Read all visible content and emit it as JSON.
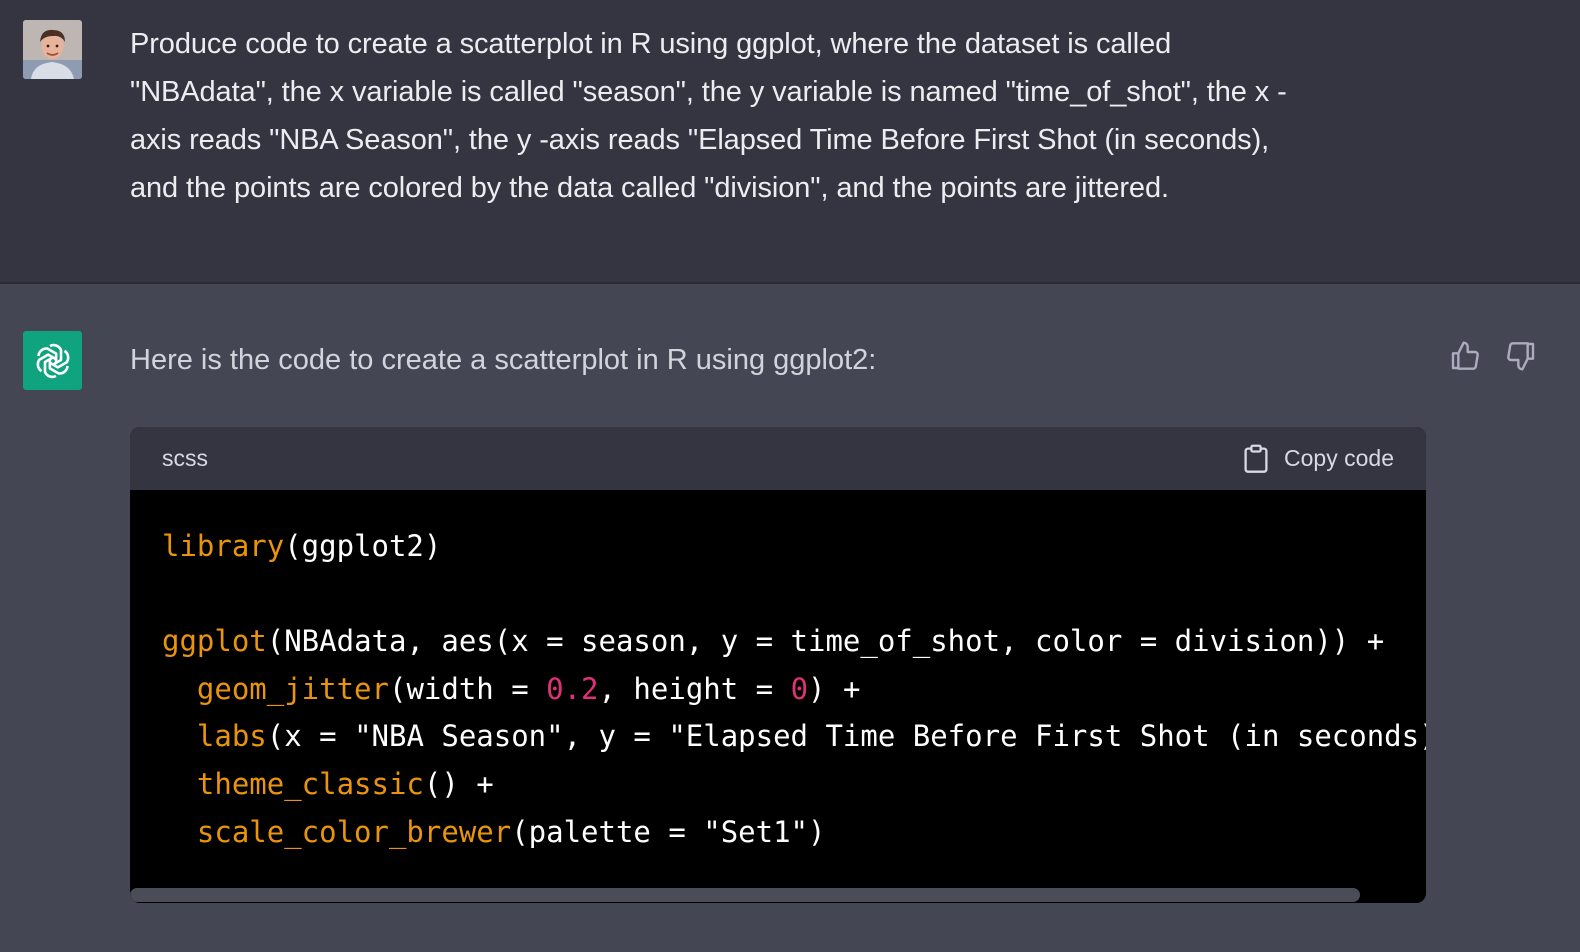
{
  "user": {
    "avatar": "user-photo-avatar",
    "prompt_lines": [
      "Produce code to create a scatterplot in R using ggplot, where the dataset is called",
      "\"NBAdata\", the x variable is called \"season\", the y variable is named \"time_of_shot\", the x -",
      "axis reads \"NBA Season\", the y -axis reads \"Elapsed Time Before First Shot (in seconds),",
      "and the points are colored by the data called \"division\", and the points are jittered."
    ]
  },
  "assistant": {
    "avatar": "openai-logo-icon",
    "intro": "Here is the code to create a scatterplot in R using ggplot2:",
    "feedback": {
      "up": "thumbs-up-icon",
      "down": "thumbs-down-icon"
    },
    "code_block": {
      "language": "scss",
      "copy_label": "Copy code",
      "lines": [
        [
          {
            "t": "library",
            "c": "fn"
          },
          {
            "t": "(ggplot2)",
            "c": "plain"
          }
        ],
        [],
        [
          {
            "t": "ggplot",
            "c": "fn"
          },
          {
            "t": "(NBAdata, aes(x = season, y = time_of_shot, color = division)) +",
            "c": "plain"
          }
        ],
        [
          {
            "t": "  ",
            "c": "plain"
          },
          {
            "t": "geom_jitter",
            "c": "fn"
          },
          {
            "t": "(width = ",
            "c": "plain"
          },
          {
            "t": "0.2",
            "c": "num"
          },
          {
            "t": ", height = ",
            "c": "plain"
          },
          {
            "t": "0",
            "c": "num"
          },
          {
            "t": ") +",
            "c": "plain"
          }
        ],
        [
          {
            "t": "  ",
            "c": "plain"
          },
          {
            "t": "labs",
            "c": "fn"
          },
          {
            "t": "(x = \"NBA Season\", y = \"Elapsed Time Before First Shot (in seconds)\")",
            "c": "plain"
          }
        ],
        [
          {
            "t": "  ",
            "c": "plain"
          },
          {
            "t": "theme_classic",
            "c": "fn"
          },
          {
            "t": "() +",
            "c": "plain"
          }
        ],
        [
          {
            "t": "  ",
            "c": "plain"
          },
          {
            "t": "scale_color_brewer",
            "c": "fn"
          },
          {
            "t": "(palette = \"Set1\")",
            "c": "plain"
          }
        ]
      ]
    }
  },
  "colors": {
    "user_bg": "#343541",
    "assistant_bg": "#444654",
    "brand": "#10a37f",
    "code_fn": "#e9950c",
    "code_num": "#df3079"
  }
}
